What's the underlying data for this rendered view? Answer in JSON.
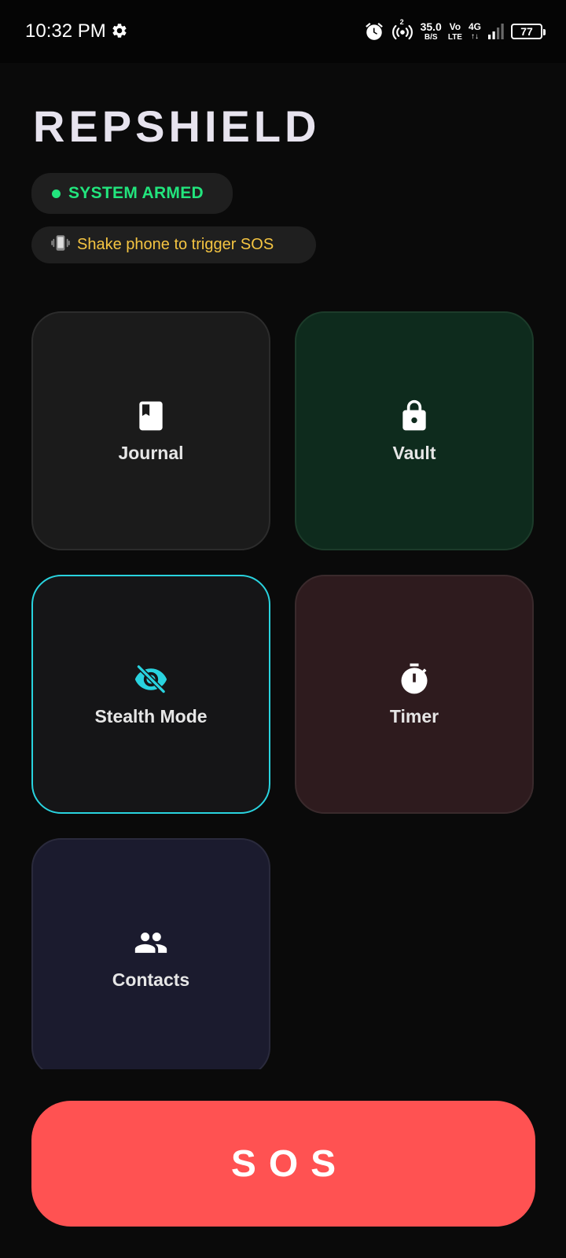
{
  "status_bar": {
    "time": "10:32 PM",
    "net_speed_value": "35.0",
    "net_speed_unit": "B/S",
    "volte_top": "Vo",
    "volte_bottom": "LTE",
    "network_type": "4G",
    "network_arrows": "↑↓",
    "hotspot_count": "2",
    "battery_level": "77",
    "icons": [
      "settings-icon",
      "alarm-icon",
      "hotspot-icon",
      "signal-icon",
      "battery-icon"
    ]
  },
  "header": {
    "title": "REPSHIELD",
    "status_label": "SYSTEM ARMED",
    "status_color": "#22e57d",
    "hint_icon": "📳",
    "hint_text": "Shake phone to trigger SOS",
    "hint_color": "#f5c542"
  },
  "tiles": {
    "journal": {
      "label": "Journal",
      "icon": "book-icon"
    },
    "vault": {
      "label": "Vault",
      "icon": "lock-icon"
    },
    "stealth": {
      "label": "Stealth Mode",
      "icon": "eye-off-icon",
      "accent": "#29d3df"
    },
    "timer": {
      "label": "Timer",
      "icon": "stopwatch-icon"
    },
    "contacts": {
      "label": "Contacts",
      "icon": "people-icon"
    }
  },
  "sos": {
    "label": "SOS",
    "color": "#ff5252"
  }
}
